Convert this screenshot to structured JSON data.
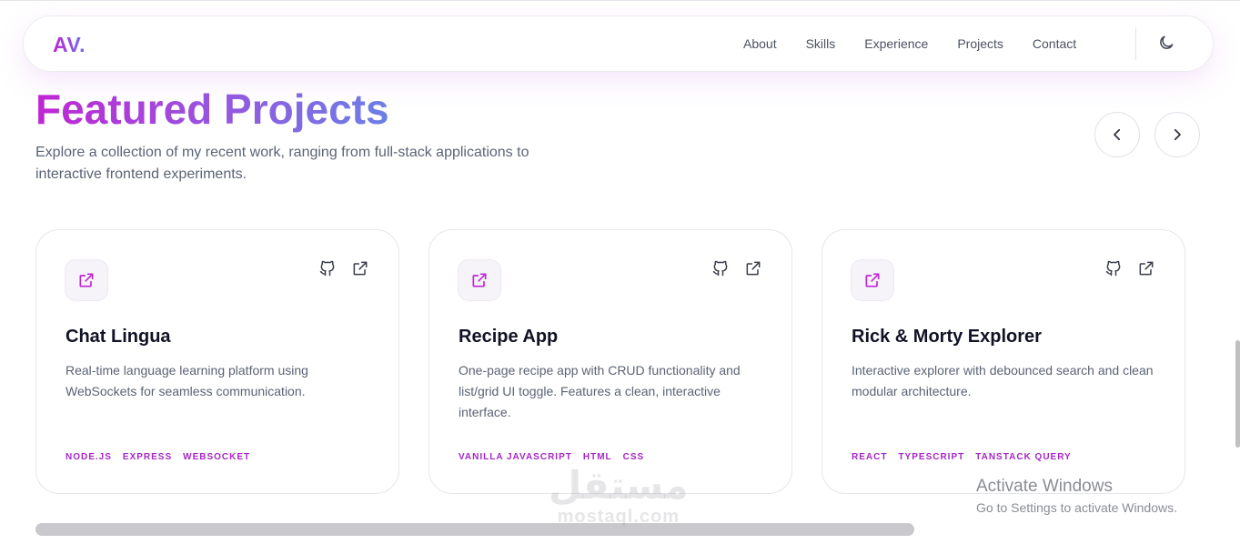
{
  "nav": {
    "logo": "AV.",
    "links": [
      "About",
      "Skills",
      "Experience",
      "Projects",
      "Contact"
    ],
    "theme_icon": "moon-icon"
  },
  "hero": {
    "title": "Featured Projects",
    "subtitle": "Explore a collection of my recent work, ranging from full-stack applications to interactive frontend experiments."
  },
  "carousel": {
    "prev_icon": "chevron-left-icon",
    "next_icon": "chevron-right-icon"
  },
  "projects": [
    {
      "title": "Chat Lingua",
      "description": "Real-time language learning platform using WebSockets for seamless communication.",
      "tags": [
        "NODE.JS",
        "EXPRESS",
        "WEBSOCKET"
      ]
    },
    {
      "title": "Recipe App",
      "description": "One-page recipe app with CRUD functionality and list/grid UI toggle. Features a clean, interactive interface.",
      "tags": [
        "VANILLA JAVASCRIPT",
        "HTML",
        "CSS"
      ]
    },
    {
      "title": "Rick & Morty Explorer",
      "description": "Interactive explorer with debounced search and clean modular architecture.",
      "tags": [
        "REACT",
        "TYPESCRIPT",
        "TANSTACK QUERY"
      ]
    }
  ],
  "watermark": {
    "arabic": "مستقل",
    "latin": "mostaql.com"
  },
  "windows_notice": {
    "title": "Activate Windows",
    "subtitle": "Go to Settings to activate Windows."
  },
  "colors": {
    "accent": "#c026d3",
    "accent_end": "#6b7fe6",
    "tag": "#a626c9"
  }
}
